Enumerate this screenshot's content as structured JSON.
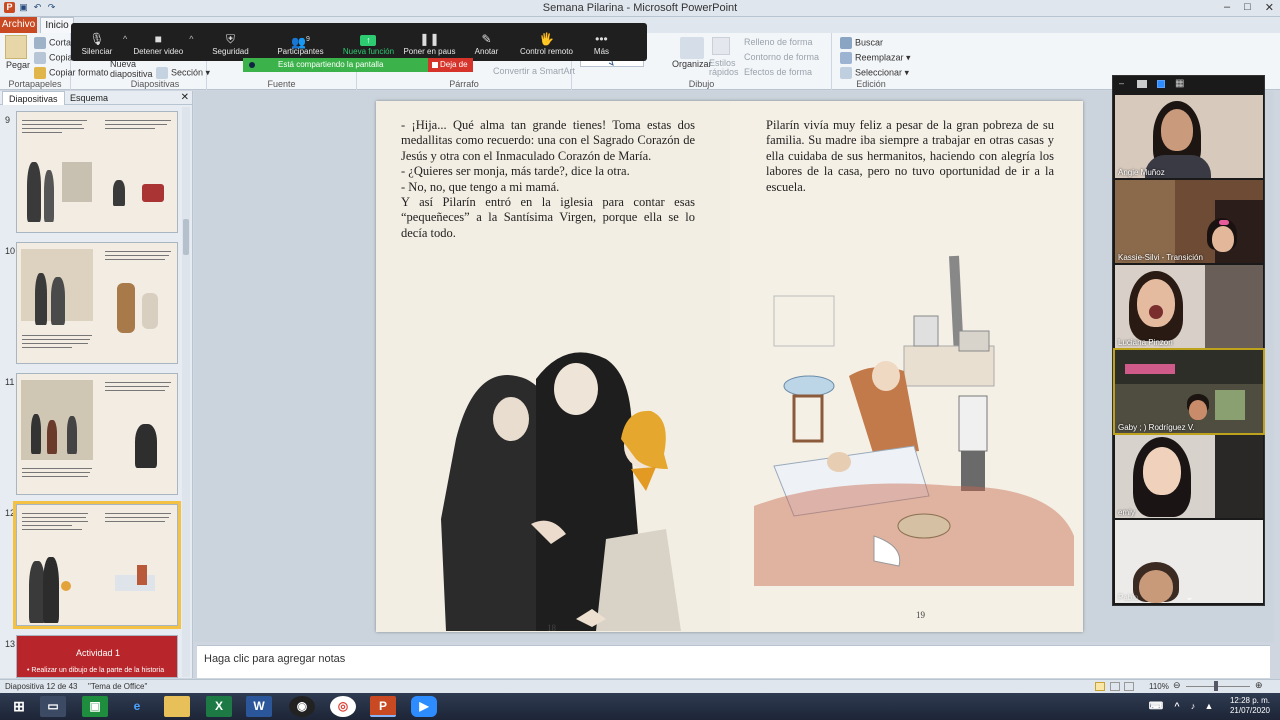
{
  "window": {
    "title": "Semana Pilarina - Microsoft PowerPoint",
    "controls": [
      "–",
      "□",
      "✕"
    ]
  },
  "ribbon": {
    "tabs": {
      "archivo": "Archivo",
      "inicio": "Inicio"
    },
    "portapapeles": {
      "paste": "Pegar",
      "cut": "Cortar",
      "copy": "Copiar",
      "format": "Copiar formato",
      "label": "Portapapeles"
    },
    "diapositivas": {
      "new": "Nueva diapositiva",
      "section": "Sección",
      "label": "Diapositivas"
    },
    "fuente": {
      "label": "Fuente"
    },
    "parrafo": {
      "smartart": "Convertir a SmartArt",
      "label": "Párrafo"
    },
    "dibujo": {
      "organize": "Organizar",
      "styles": "Estilos rápidos",
      "fill": "Relleno de forma",
      "outline": "Contorno de forma",
      "effects": "Efectos de forma",
      "label": "Dibujo"
    },
    "edicion": {
      "find": "Buscar",
      "replace": "Reemplazar",
      "select": "Seleccionar",
      "label": "Edición"
    }
  },
  "zoom": {
    "items": [
      {
        "icon": "🎙",
        "label": "Silenciar"
      },
      {
        "icon": "■",
        "label": "Detener video"
      },
      {
        "icon": "⛨",
        "label": "Seguridad"
      },
      {
        "icon": "👥",
        "label": "Participantes",
        "count": "9"
      },
      {
        "icon": "↑",
        "label": "Nueva función"
      },
      {
        "icon": "❚❚",
        "label": "Poner en paus"
      },
      {
        "icon": "✎",
        "label": "Anotar"
      },
      {
        "icon": "🖐",
        "label": "Control remoto"
      },
      {
        "icon": "•••",
        "label": "Más"
      }
    ],
    "sharing": "Está compartiendo la pantalla",
    "stop": "Deja de"
  },
  "left_panel": {
    "tab_slides": "Diapositivas",
    "tab_outline": "Esquema",
    "thumb_numbers": [
      "9",
      "10",
      "11",
      "12",
      "13"
    ],
    "slide13_title": "Actividad 1",
    "slide13_text": "• Realizar un dibujo de la parte de la historia"
  },
  "slide": {
    "left_text": "- ¡Hija... Qué alma tan grande tienes! Toma estas dos medallitas como recuerdo: una con el Sagrado Corazón de Jesús y otra con el Inmaculado Corazón de María.\n- ¿Quieres ser monja, más tarde?, dice la otra.\n- No, no, que tengo a mi mamá.\nY así Pilarín entró en la iglesia para contar esas “pequeñeces” a la Santísima Virgen, porque ella se lo decía todo.",
    "right_text": "Pilarín vivía muy feliz a pesar de la gran pobreza de su familia. Su madre iba siempre a trabajar en otras casas y ella cuidaba de sus hermanitos, haciendo con alegría los labores de la casa, pero no tuvo oportunidad de ir a la escuela.",
    "page_left": "18",
    "page_right": "19"
  },
  "notes": {
    "placeholder": "Haga clic para agregar notas"
  },
  "status": {
    "slide_info": "Diapositiva 12 de 43",
    "theme": "\"Tema de Office\"",
    "zoom": "110%"
  },
  "gallery": {
    "participants": [
      {
        "name": "Angie Muñoz",
        "bg": "#c9b8a8"
      },
      {
        "name": "Kassie-Silvi - Transición",
        "bg": "#7b5a40"
      },
      {
        "name": "Luciana Pinzon",
        "bg": "#ddd5cc"
      },
      {
        "name": "Gaby ; ) Rodríguez V.",
        "bg": "#5a5a4a"
      },
      {
        "name": "emiy",
        "bg": "#d8d2cc"
      },
      {
        "name": "Pablo",
        "bg": "#e8e6e4"
      }
    ]
  },
  "taskbar": {
    "time": "12:28 p. m.",
    "date": "21/07/2020"
  }
}
